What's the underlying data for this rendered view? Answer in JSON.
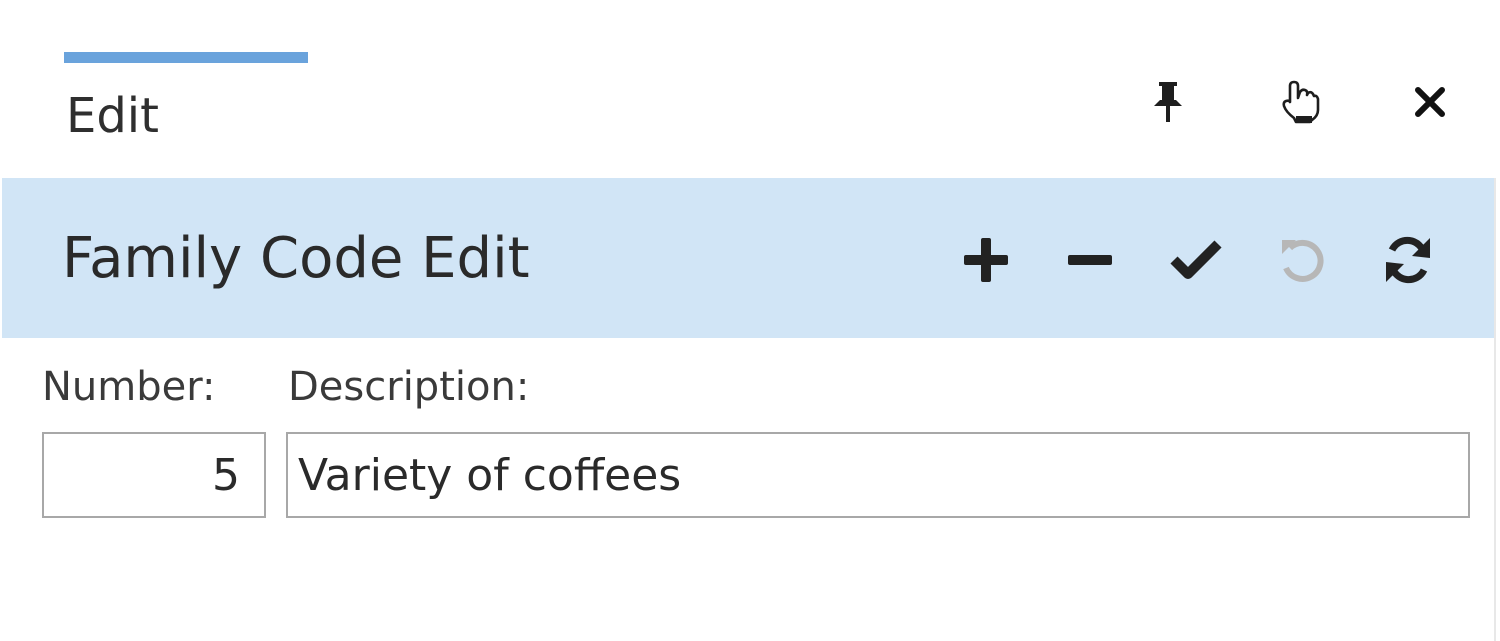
{
  "tab": {
    "label": "Edit"
  },
  "window_controls": [
    {
      "name": "pin-icon",
      "tooltip": ""
    },
    {
      "name": "hand-pointer-icon",
      "tooltip": ""
    },
    {
      "name": "close-icon",
      "tooltip": ""
    }
  ],
  "header": {
    "title": "Family Code Edit"
  },
  "toolbar": [
    {
      "name": "plus-icon",
      "enabled": true
    },
    {
      "name": "minus-icon",
      "enabled": true
    },
    {
      "name": "check-icon",
      "enabled": true
    },
    {
      "name": "undo-icon",
      "enabled": false
    },
    {
      "name": "refresh-icon",
      "enabled": true
    }
  ],
  "form": {
    "number": {
      "label": "Number:",
      "value": "5"
    },
    "description": {
      "label": "Description:",
      "value": "Variety of coffees"
    }
  },
  "colors": {
    "tab_indicator": "#6aa3dc",
    "header_bg": "#d1e5f6",
    "icon": "#222222",
    "icon_disabled": "#b7b7b7",
    "input_border": "#a8a8a8"
  }
}
